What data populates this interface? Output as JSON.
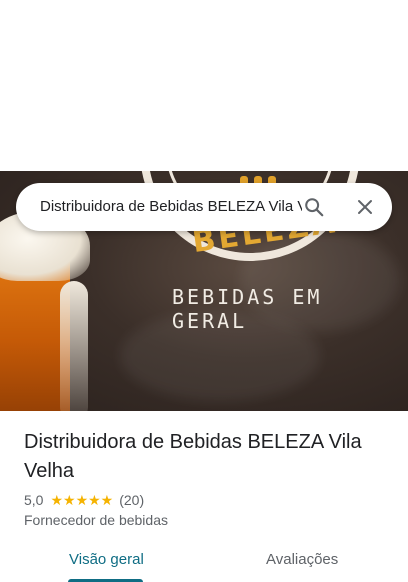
{
  "search": {
    "query": "Distribuidora de Bebidas BELEZA Vila Velha"
  },
  "hero": {
    "logo_text": "BELEZA",
    "logo_subtext": "BEBIDAS EM GERAL"
  },
  "place": {
    "name": "Distribuidora de Bebidas BELEZA Vila Velha",
    "rating": "5,0",
    "stars": "★★★★★",
    "rating_value": 5.0,
    "review_count": "(20)",
    "category": "Fornecedor de bebidas"
  },
  "tabs": [
    {
      "label": "Visão geral",
      "active": true
    },
    {
      "label": "Avaliações",
      "active": false
    }
  ],
  "colors": {
    "accent": "#0f6d84",
    "star": "#f5b301",
    "text_primary": "#202124",
    "text_secondary": "#5f6368"
  }
}
